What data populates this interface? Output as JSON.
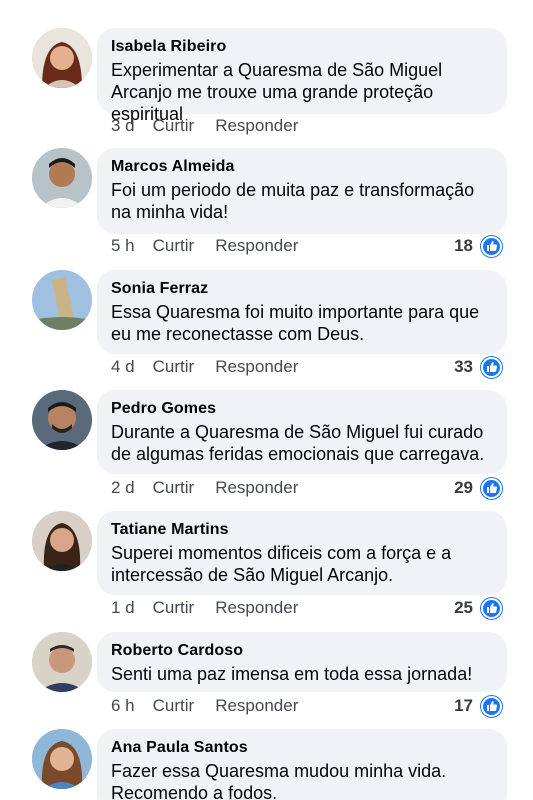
{
  "colors": {
    "bubble": "#f0f2f5",
    "like_blue": "#1877f2",
    "meta_text": "#444950"
  },
  "actions": {
    "like_label": "Curtir",
    "reply_label": "Responder"
  },
  "icons": {
    "reaction": "like-thumbs-up-icon"
  },
  "comments": [
    {
      "author": "Isabela Ribeiro",
      "text": "Experimentar a Quaresma de São Miguel Arcanjo me trouxe uma grande proteção espiritual",
      "time": "3 d",
      "reactions": ""
    },
    {
      "author": "Marcos Almeida",
      "text": "Foi um periodo de muita paz e transformação na minha vida!",
      "time": "5 h",
      "reactions": "18"
    },
    {
      "author": "Sonia Ferraz",
      "text": "Essa Quaresma foi muito importante para que eu me reconectasse com Deus.",
      "time": "4 d",
      "reactions": "33"
    },
    {
      "author": "Pedro Gomes",
      "text": "Durante a Quaresma de São Miguel fui curado de algumas feridas emocionais que carregava.",
      "time": "2 d",
      "reactions": "29"
    },
    {
      "author": "Tatiane Martins",
      "text": "Superei momentos dificeis com a força e a intercessão de São Miguel Arcanjo.",
      "time": "1 d",
      "reactions": "25"
    },
    {
      "author": "Roberto Cardoso",
      "text": "Senti uma paz imensa em toda essa jornada!",
      "time": "6 h",
      "reactions": "17"
    },
    {
      "author": "Ana Paula Santos",
      "text": "Fazer essa Quaresma mudou minha vida. Recomendo a fodos.",
      "time": "",
      "reactions": ""
    }
  ]
}
